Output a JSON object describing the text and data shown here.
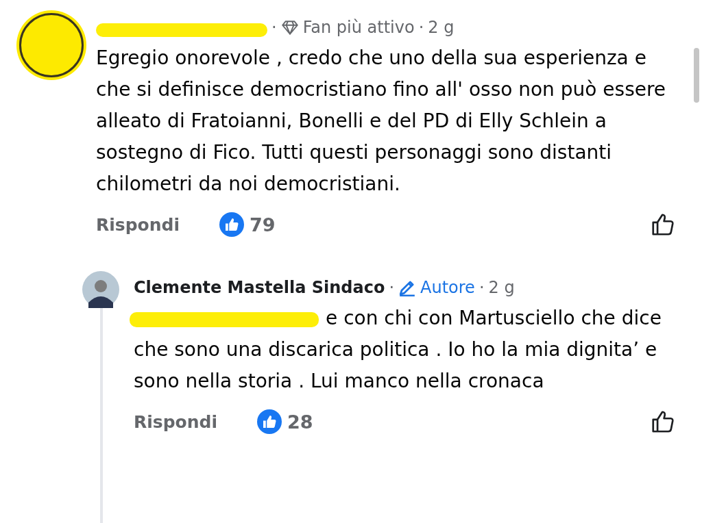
{
  "comments": [
    {
      "avatar": {
        "kind": "redacted"
      },
      "name_redacted": true,
      "separator": "·",
      "badge": {
        "kind": "fan",
        "label": "Fan più attivo"
      },
      "time_separator": "·",
      "time": "2 g",
      "mention_redacted": false,
      "text": "Egregio onorevole , credo che uno della sua esperienza e che si definisce democristiano fino all' osso non può essere alleato di Fratoianni, Bonelli e del PD di Elly Schlein a sostegno di Fico. Tutti questi personaggi sono distanti chilometri da noi democristiani.",
      "reply_label": "Rispondi",
      "likes": "79",
      "replies": [
        {
          "avatar": {
            "kind": "person"
          },
          "name_redacted": false,
          "name": "Clemente Mastella Sindaco",
          "separator": "·",
          "badge": {
            "kind": "author",
            "label": "Autore"
          },
          "time_separator": "·",
          "time": "2 g",
          "mention_redacted": true,
          "text": "e con chi con Martusciello che dice che sono una discarica politica . Io ho la mia dignita’ e sono nella storia .  Lui manco nella cronaca",
          "reply_label": "Rispondi",
          "likes": "28"
        }
      ]
    }
  ]
}
